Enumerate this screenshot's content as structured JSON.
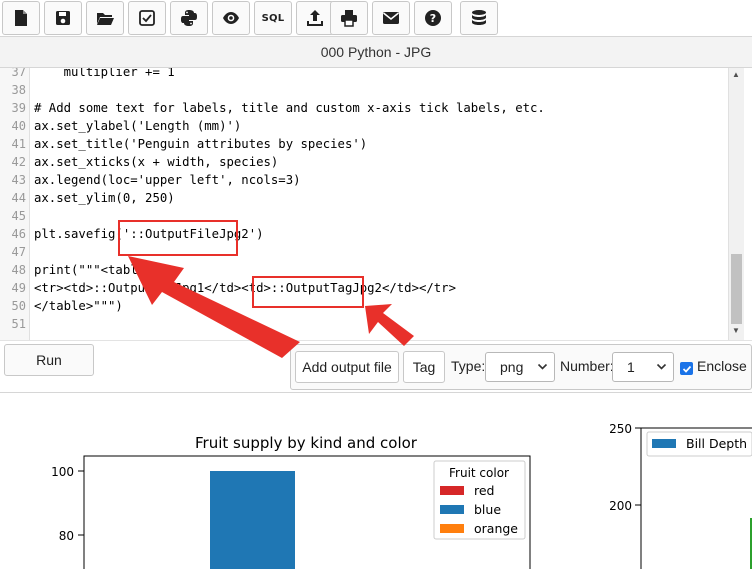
{
  "toolbar": {
    "icons": [
      "new-file-icon",
      "save-icon",
      "open-folder-icon",
      "checkbox-icon",
      "python-icon",
      "eye-icon",
      "sql-icon",
      "upload-icon",
      "print-icon",
      "mail-icon",
      "help-icon",
      "database-icon"
    ],
    "sql_label": "SQL"
  },
  "window": {
    "title": "000 Python - JPG"
  },
  "editor": {
    "lines": [
      {
        "n": "37",
        "text": "    multiplier += 1"
      },
      {
        "n": "38",
        "text": ""
      },
      {
        "n": "39",
        "text": "# Add some text for labels, title and custom x-axis tick labels, etc."
      },
      {
        "n": "40",
        "text": "ax.set_ylabel('Length (mm)')"
      },
      {
        "n": "41",
        "text": "ax.set_title('Penguin attributes by species')"
      },
      {
        "n": "42",
        "text": "ax.set_xticks(x + width, species)"
      },
      {
        "n": "43",
        "text": "ax.legend(loc='upper left', ncols=3)"
      },
      {
        "n": "44",
        "text": "ax.set_ylim(0, 250)"
      },
      {
        "n": "45",
        "text": ""
      },
      {
        "n": "46",
        "text": "plt.savefig('::OutputFileJpg2')"
      },
      {
        "n": "47",
        "text": ""
      },
      {
        "n": "48",
        "text": "print(\"\"\"<table>"
      },
      {
        "n": "49",
        "text": "<tr><td>::OutputTagJpg1</td><td>::OutputTagJpg2</td></tr>"
      },
      {
        "n": "50",
        "text": "</table>\"\"\")"
      },
      {
        "n": "51",
        "text": ""
      }
    ]
  },
  "controls": {
    "run_label": "Run",
    "add_output_label": "Add output file",
    "tag_label": "Tag",
    "type_label": "Type:",
    "type_value": "png",
    "number_label": "Number:",
    "number_value": "1",
    "enclose_label": "Enclose",
    "enclose_checked": true
  },
  "output": {
    "chart1": {
      "title": "Fruit supply by kind and color",
      "y_ticks": [
        "100",
        "80"
      ],
      "legend_title": "Fruit color",
      "legend": [
        {
          "label": "red",
          "color": "#d62728"
        },
        {
          "label": "blue",
          "color": "#1f77b4"
        },
        {
          "label": "orange",
          "color": "#ff7f0e"
        }
      ],
      "bar_value": 100,
      "bar_color": "#1f77b4"
    },
    "chart2": {
      "y_ticks": [
        "250",
        "200"
      ],
      "legend_label": "Bill Depth",
      "legend_color": "#1f77b4"
    }
  },
  "colors": {
    "annotation": "#e8302a"
  }
}
